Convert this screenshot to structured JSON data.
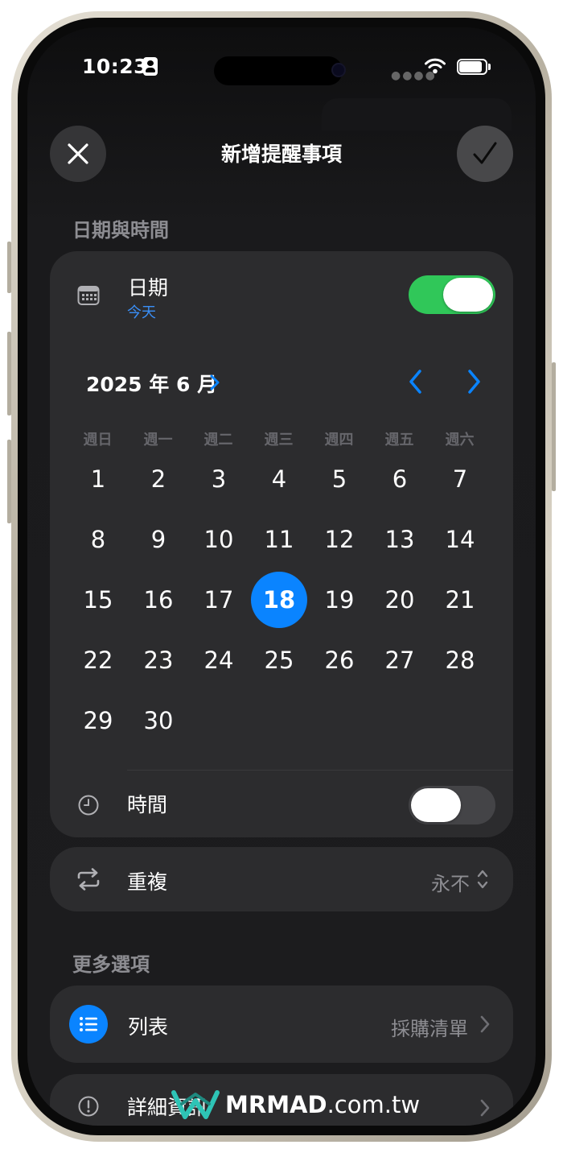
{
  "status_bar": {
    "time": "10:23"
  },
  "nav": {
    "title": "新增提醒事項"
  },
  "sections": {
    "date_time": "日期與時間",
    "more_options": "更多選項"
  },
  "date_row": {
    "label": "日期",
    "subtitle": "今天",
    "toggle_on": true
  },
  "calendar": {
    "month_label": "2025 年 6 月",
    "weekdays": [
      "週日",
      "週一",
      "週二",
      "週三",
      "週四",
      "週五",
      "週六"
    ],
    "days": [
      "1",
      "2",
      "3",
      "4",
      "5",
      "6",
      "7",
      "8",
      "9",
      "10",
      "11",
      "12",
      "13",
      "14",
      "15",
      "16",
      "17",
      "18",
      "19",
      "20",
      "21",
      "22",
      "23",
      "24",
      "25",
      "26",
      "27",
      "28",
      "29",
      "30"
    ],
    "selected_day": "18"
  },
  "time_row": {
    "label": "時間",
    "toggle_on": false
  },
  "repeat_row": {
    "label": "重複",
    "value": "永不"
  },
  "list_row": {
    "label": "列表",
    "value": "採購清單"
  },
  "detail_row": {
    "label": "詳細資訊"
  },
  "watermark": {
    "brand": "MRMAD",
    "domain": ".com.tw"
  },
  "colors": {
    "accent_blue": "#0a84ff",
    "toggle_green": "#30c759",
    "card_bg": "#2c2c2e",
    "secondary_text": "#8d8d92"
  },
  "icons": {
    "close": "close-icon",
    "confirm": "checkmark-icon",
    "calendar": "calendar-icon",
    "clock": "clock-icon",
    "repeat": "repeat-icon",
    "list": "list-icon",
    "info": "info-icon"
  }
}
